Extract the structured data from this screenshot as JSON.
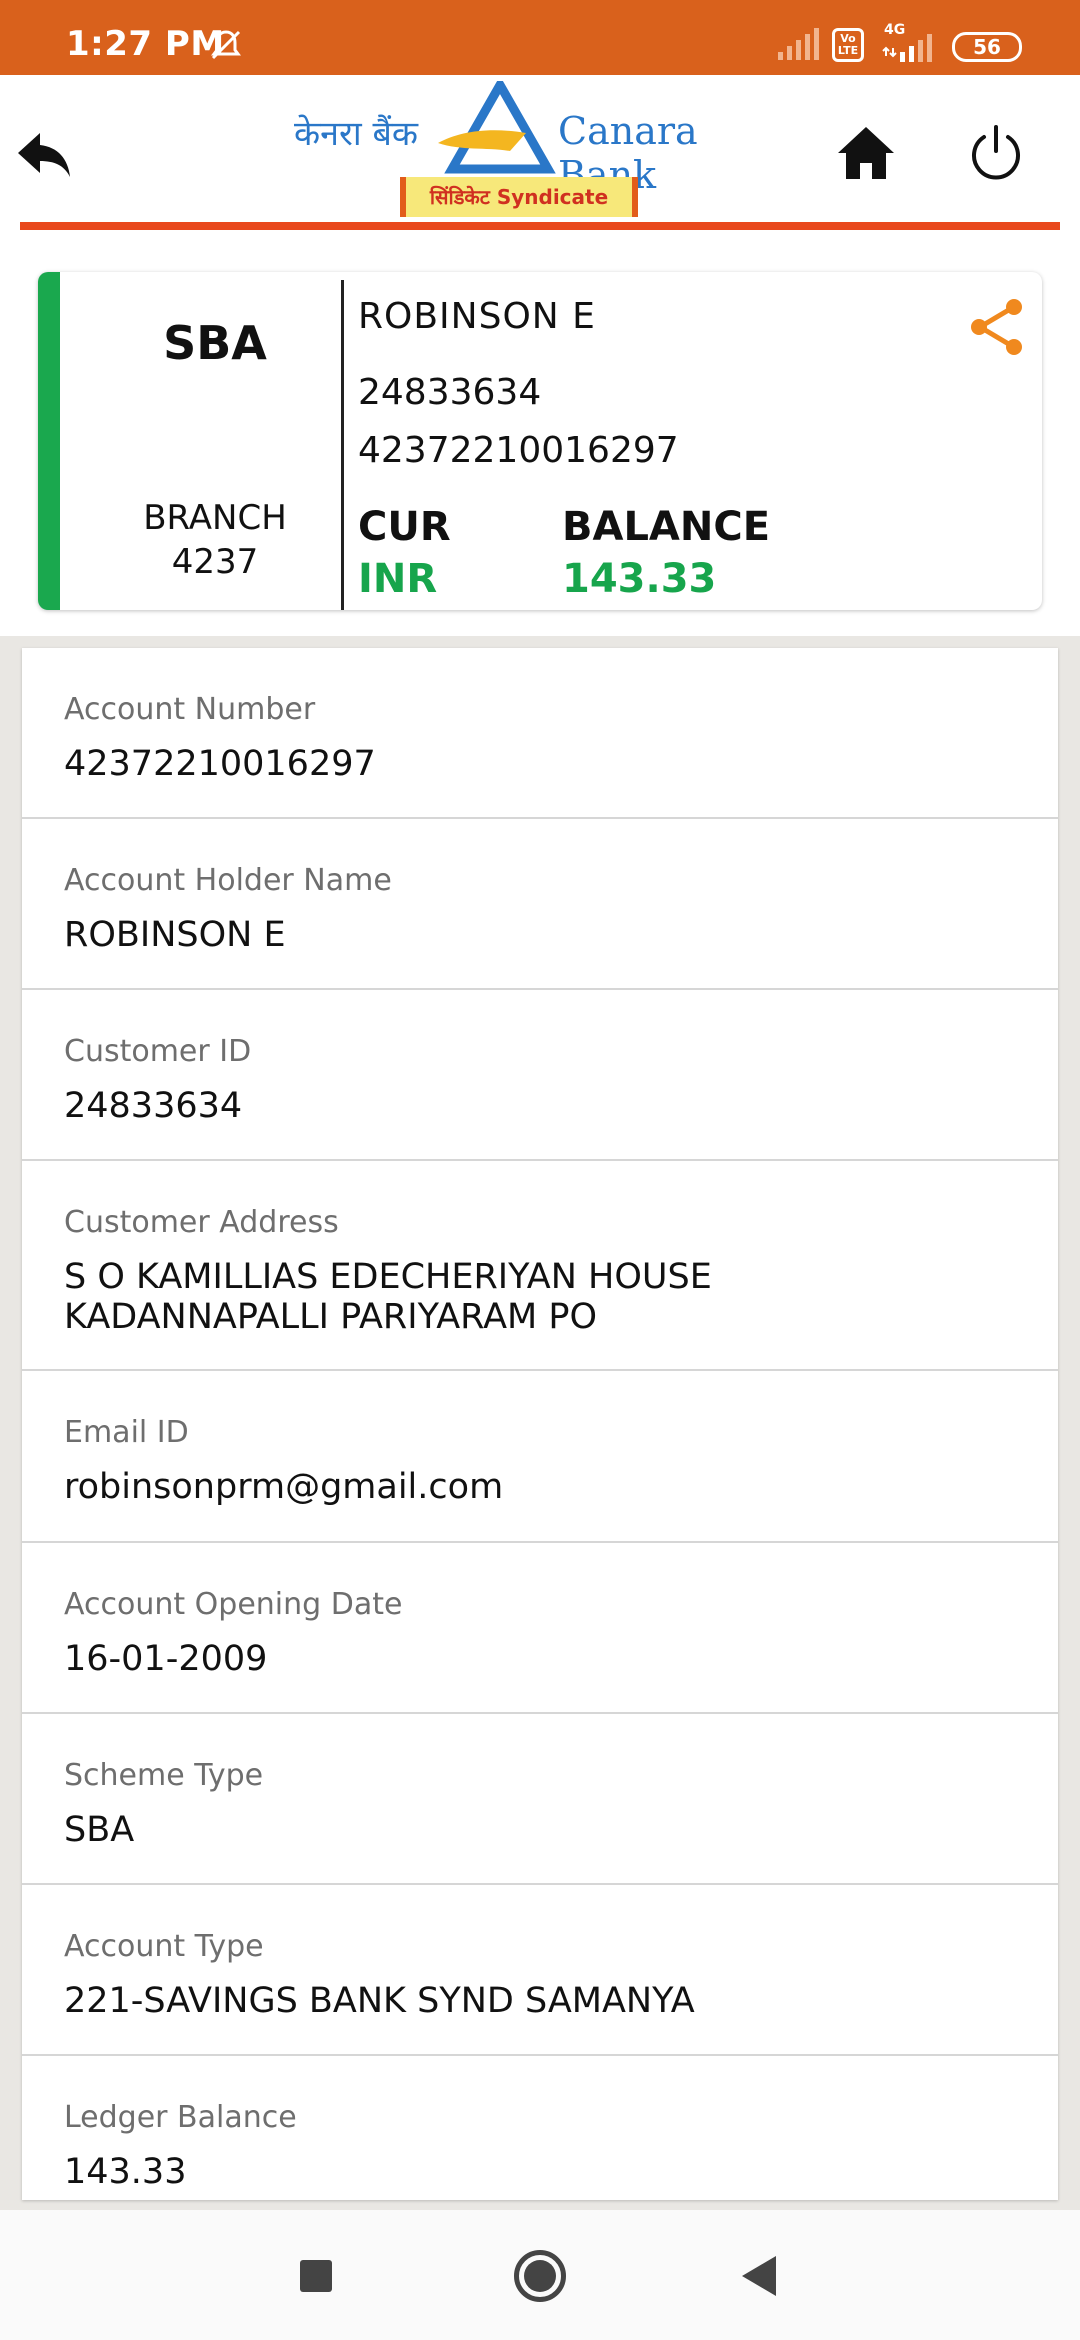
{
  "status_bar": {
    "time": "1:27 PM",
    "volte_label": "Vo LTE",
    "network": "4G",
    "battery": "56"
  },
  "header": {
    "logo": {
      "hindi_text": "केनरा बैंक",
      "english_text": "Canara Bank",
      "sub_brand": "सिंडिकेट Syndicate"
    },
    "icons": [
      "back-arrow-icon",
      "home-icon",
      "power-icon"
    ]
  },
  "summary": {
    "scheme": "SBA",
    "branch_label": "BRANCH",
    "branch_code": "4237",
    "holder_name": "ROBINSON  E",
    "customer_id": "24833634",
    "account_number": "42372210016297",
    "currency_label": "CUR",
    "currency_value": "INR",
    "balance_label": "BALANCE",
    "balance_value": "143.33",
    "share_icon": "share-icon"
  },
  "details": [
    {
      "label": "Account Number",
      "value": "42372210016297"
    },
    {
      "label": "Account Holder Name",
      "value": "ROBINSON  E"
    },
    {
      "label": "Customer ID",
      "value": "24833634"
    },
    {
      "label": "Customer Address",
      "value": "S O  KAMILLIAS EDECHERIYAN HOUSE\nKADANNAPALLI PARIYARAM PO"
    },
    {
      "label": "Email ID",
      "value": "robinsonprm@gmail.com"
    },
    {
      "label": "Account Opening Date",
      "value": "16-01-2009"
    },
    {
      "label": "Scheme Type",
      "value": "SBA"
    },
    {
      "label": "Account Type",
      "value": "221-SAVINGS BANK SYND SAMANYA"
    },
    {
      "label": "Ledger Balance",
      "value": "143.33"
    }
  ],
  "colors": {
    "status_bar": "#d9611c",
    "accent_green": "#1aa84e",
    "share_orange": "#f0891e",
    "header_rule": "#e9481c",
    "logo_blue": "#2a77c8"
  }
}
